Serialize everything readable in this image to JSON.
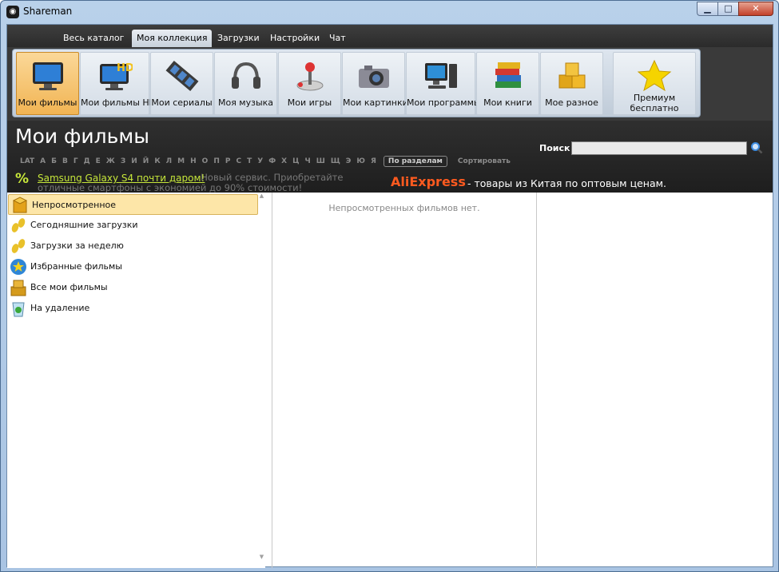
{
  "window": {
    "title": "Shareman",
    "minimize": "▁",
    "maximize": "□",
    "close": "✕"
  },
  "menu": {
    "tabs": [
      "Весь каталог",
      "Моя коллекция",
      "Загрузки",
      "Настройки",
      "Чат"
    ],
    "active": "Моя коллекция"
  },
  "toolbar": {
    "items": [
      "Мои фильмы",
      "Мои фильмы HD",
      "Мои сериалы",
      "Моя музыка",
      "Мои игры",
      "Мои картинки",
      "Мои программы",
      "Мои книги",
      "Мое разное"
    ],
    "active": "Мои фильмы",
    "premium": "Премиум бесплатно"
  },
  "header": {
    "title": "Мои фильмы",
    "alphabet": [
      "LAT",
      "А",
      "Б",
      "В",
      "Г",
      "Д",
      "Е",
      "Ж",
      "З",
      "И",
      "Й",
      "К",
      "Л",
      "М",
      "Н",
      "О",
      "П",
      "Р",
      "С",
      "Т",
      "У",
      "Ф",
      "Х",
      "Ц",
      "Ч",
      "Ш",
      "Щ",
      "Э",
      "Ю",
      "Я"
    ],
    "by_sections": "По разделам",
    "sort": "Сортировать",
    "search_label": "Поиск",
    "search_value": ""
  },
  "ad": {
    "icon": "%",
    "link": "Samsung Galaxy S4 почти даром!",
    "text": " Новый сервис. Приобретайте отличные смартфоны с экономией до 90% стоимости!",
    "brand": "AliExpress",
    "tagline": "- товары из Китая по оптовым ценам."
  },
  "sidebar": {
    "items": [
      {
        "label": "Непросмотренное",
        "icon": "box-icon",
        "active": true
      },
      {
        "label": "Сегодняшние загрузки",
        "icon": "footprints-icon"
      },
      {
        "label": "Загрузки за неделю",
        "icon": "footprints-icon"
      },
      {
        "label": "Избранные фильмы",
        "icon": "star-badge-icon"
      },
      {
        "label": "Все мои фильмы",
        "icon": "box-stack-icon"
      },
      {
        "label": "На удаление",
        "icon": "recycle-bin-icon"
      }
    ]
  },
  "content": {
    "empty_message": "Непросмотренных фильмов нет."
  }
}
